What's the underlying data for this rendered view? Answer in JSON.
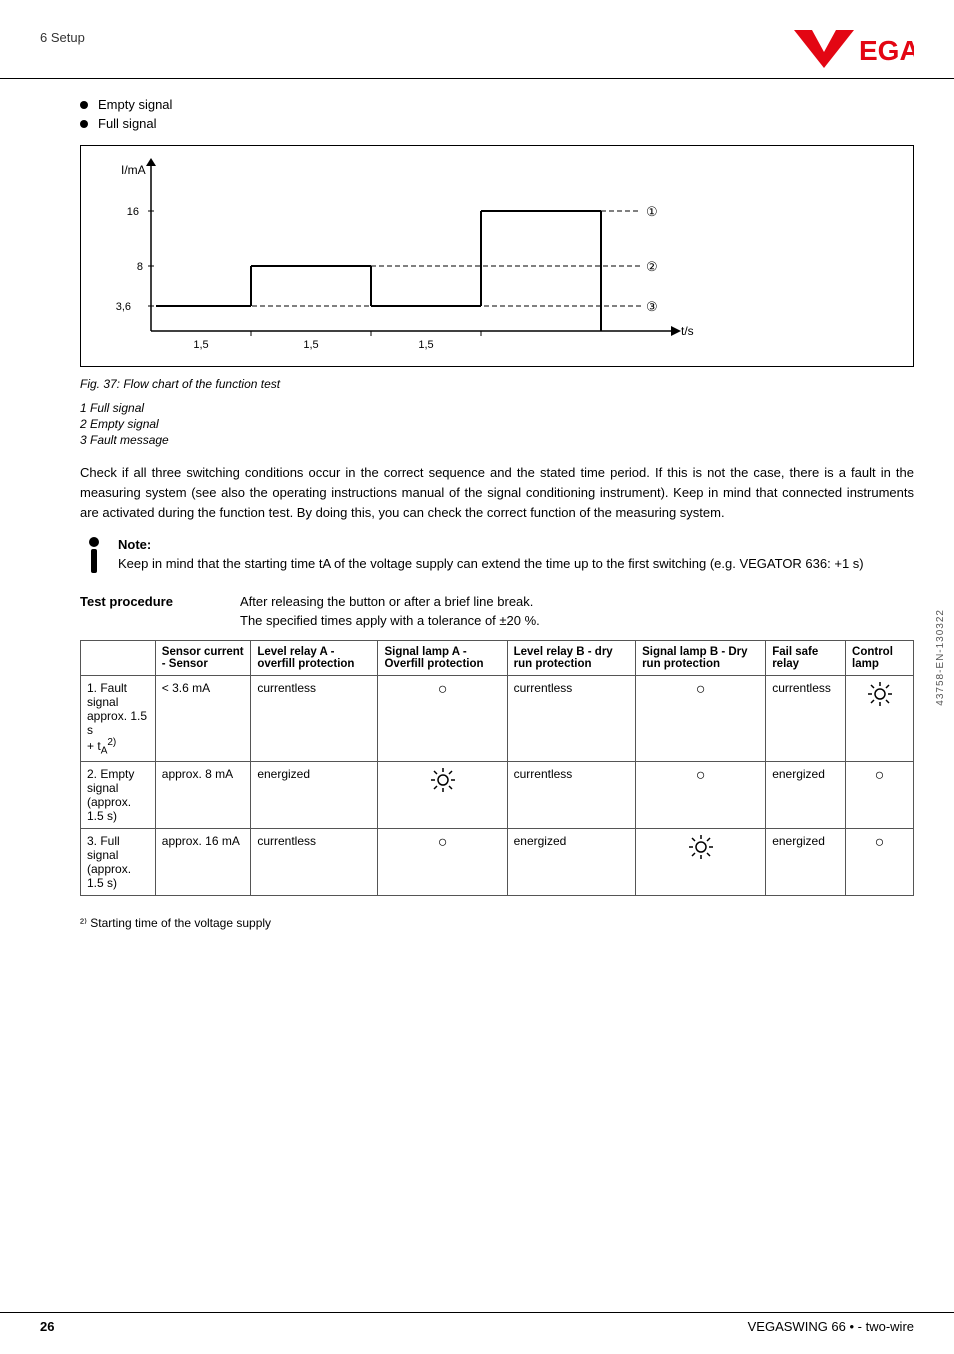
{
  "header": {
    "title": "6 Setup",
    "logo_text": "VEGA"
  },
  "bullets": [
    "Empty signal",
    "Full signal"
  ],
  "chart": {
    "y_axis_label": "I/mA",
    "y_values": [
      "16",
      "8",
      "3,6"
    ],
    "x_values": [
      "1,5",
      "1,5",
      "1,5"
    ],
    "x_axis_label": "t/s",
    "markers": [
      "①",
      "②",
      "③"
    ]
  },
  "fig_caption": "Fig. 37: Flow chart of the function test",
  "fig_items": [
    "1   Full signal",
    "2   Empty signal",
    "3   Fault message"
  ],
  "paragraph": "Check if all three switching conditions occur in the correct sequence and the stated time period. If this is not the case, there is a fault in the measuring system (see also the operating instructions manual of the signal conditioning instrument). Keep in mind that connected instruments are activated during the function test. By doing this, you can check the correct function of the measuring system.",
  "note": {
    "title": "Note:",
    "text": "Keep in mind that the starting time tA of the voltage supply can extend the time up to the first switching (e.g. VEGATOR 636: +1 s)"
  },
  "test_procedure": {
    "label": "Test procedure",
    "line1": "After releasing the button or after a brief line break.",
    "line2": "The specified times apply with a tolerance of ±20 %."
  },
  "table": {
    "headers": [
      "",
      "Sensor current - Sensor",
      "Level relay A - overfill protection",
      "Signal lamp A - Overfill protection",
      "Level relay B - dry run protection",
      "Signal lamp B - Dry run protection",
      "Fail safe relay",
      "Control lamp"
    ],
    "rows": [
      {
        "label": "1. Fault signal\napprox. 1.5 s\n+ tA²⁾",
        "sensor_current": "< 3.6 mA",
        "level_relay_a": "currentless",
        "signal_lamp_a": "circle",
        "level_relay_b": "currentless",
        "signal_lamp_b": "circle",
        "fail_safe": "currentless",
        "control_lamp": "sun"
      },
      {
        "label": "2. Empty signal\n(approx. 1.5 s)",
        "sensor_current": "approx. 8 mA",
        "level_relay_a": "energized",
        "signal_lamp_a": "sun",
        "level_relay_b": "currentless",
        "signal_lamp_b": "circle",
        "fail_safe": "energized",
        "control_lamp": "circle"
      },
      {
        "label": "3. Full signal\n(approx. 1.5 s)",
        "sensor_current": "approx. 16 mA",
        "level_relay_a": "currentless",
        "signal_lamp_a": "circle",
        "level_relay_b": "energized",
        "signal_lamp_b": "sun",
        "fail_safe": "energized",
        "control_lamp": "circle"
      }
    ]
  },
  "footnote": "²⁾   Starting time of the voltage supply",
  "footer": {
    "page": "26",
    "product": "VEGASWING 66 • - two-wire"
  },
  "sidebar": "43758-EN-130322"
}
